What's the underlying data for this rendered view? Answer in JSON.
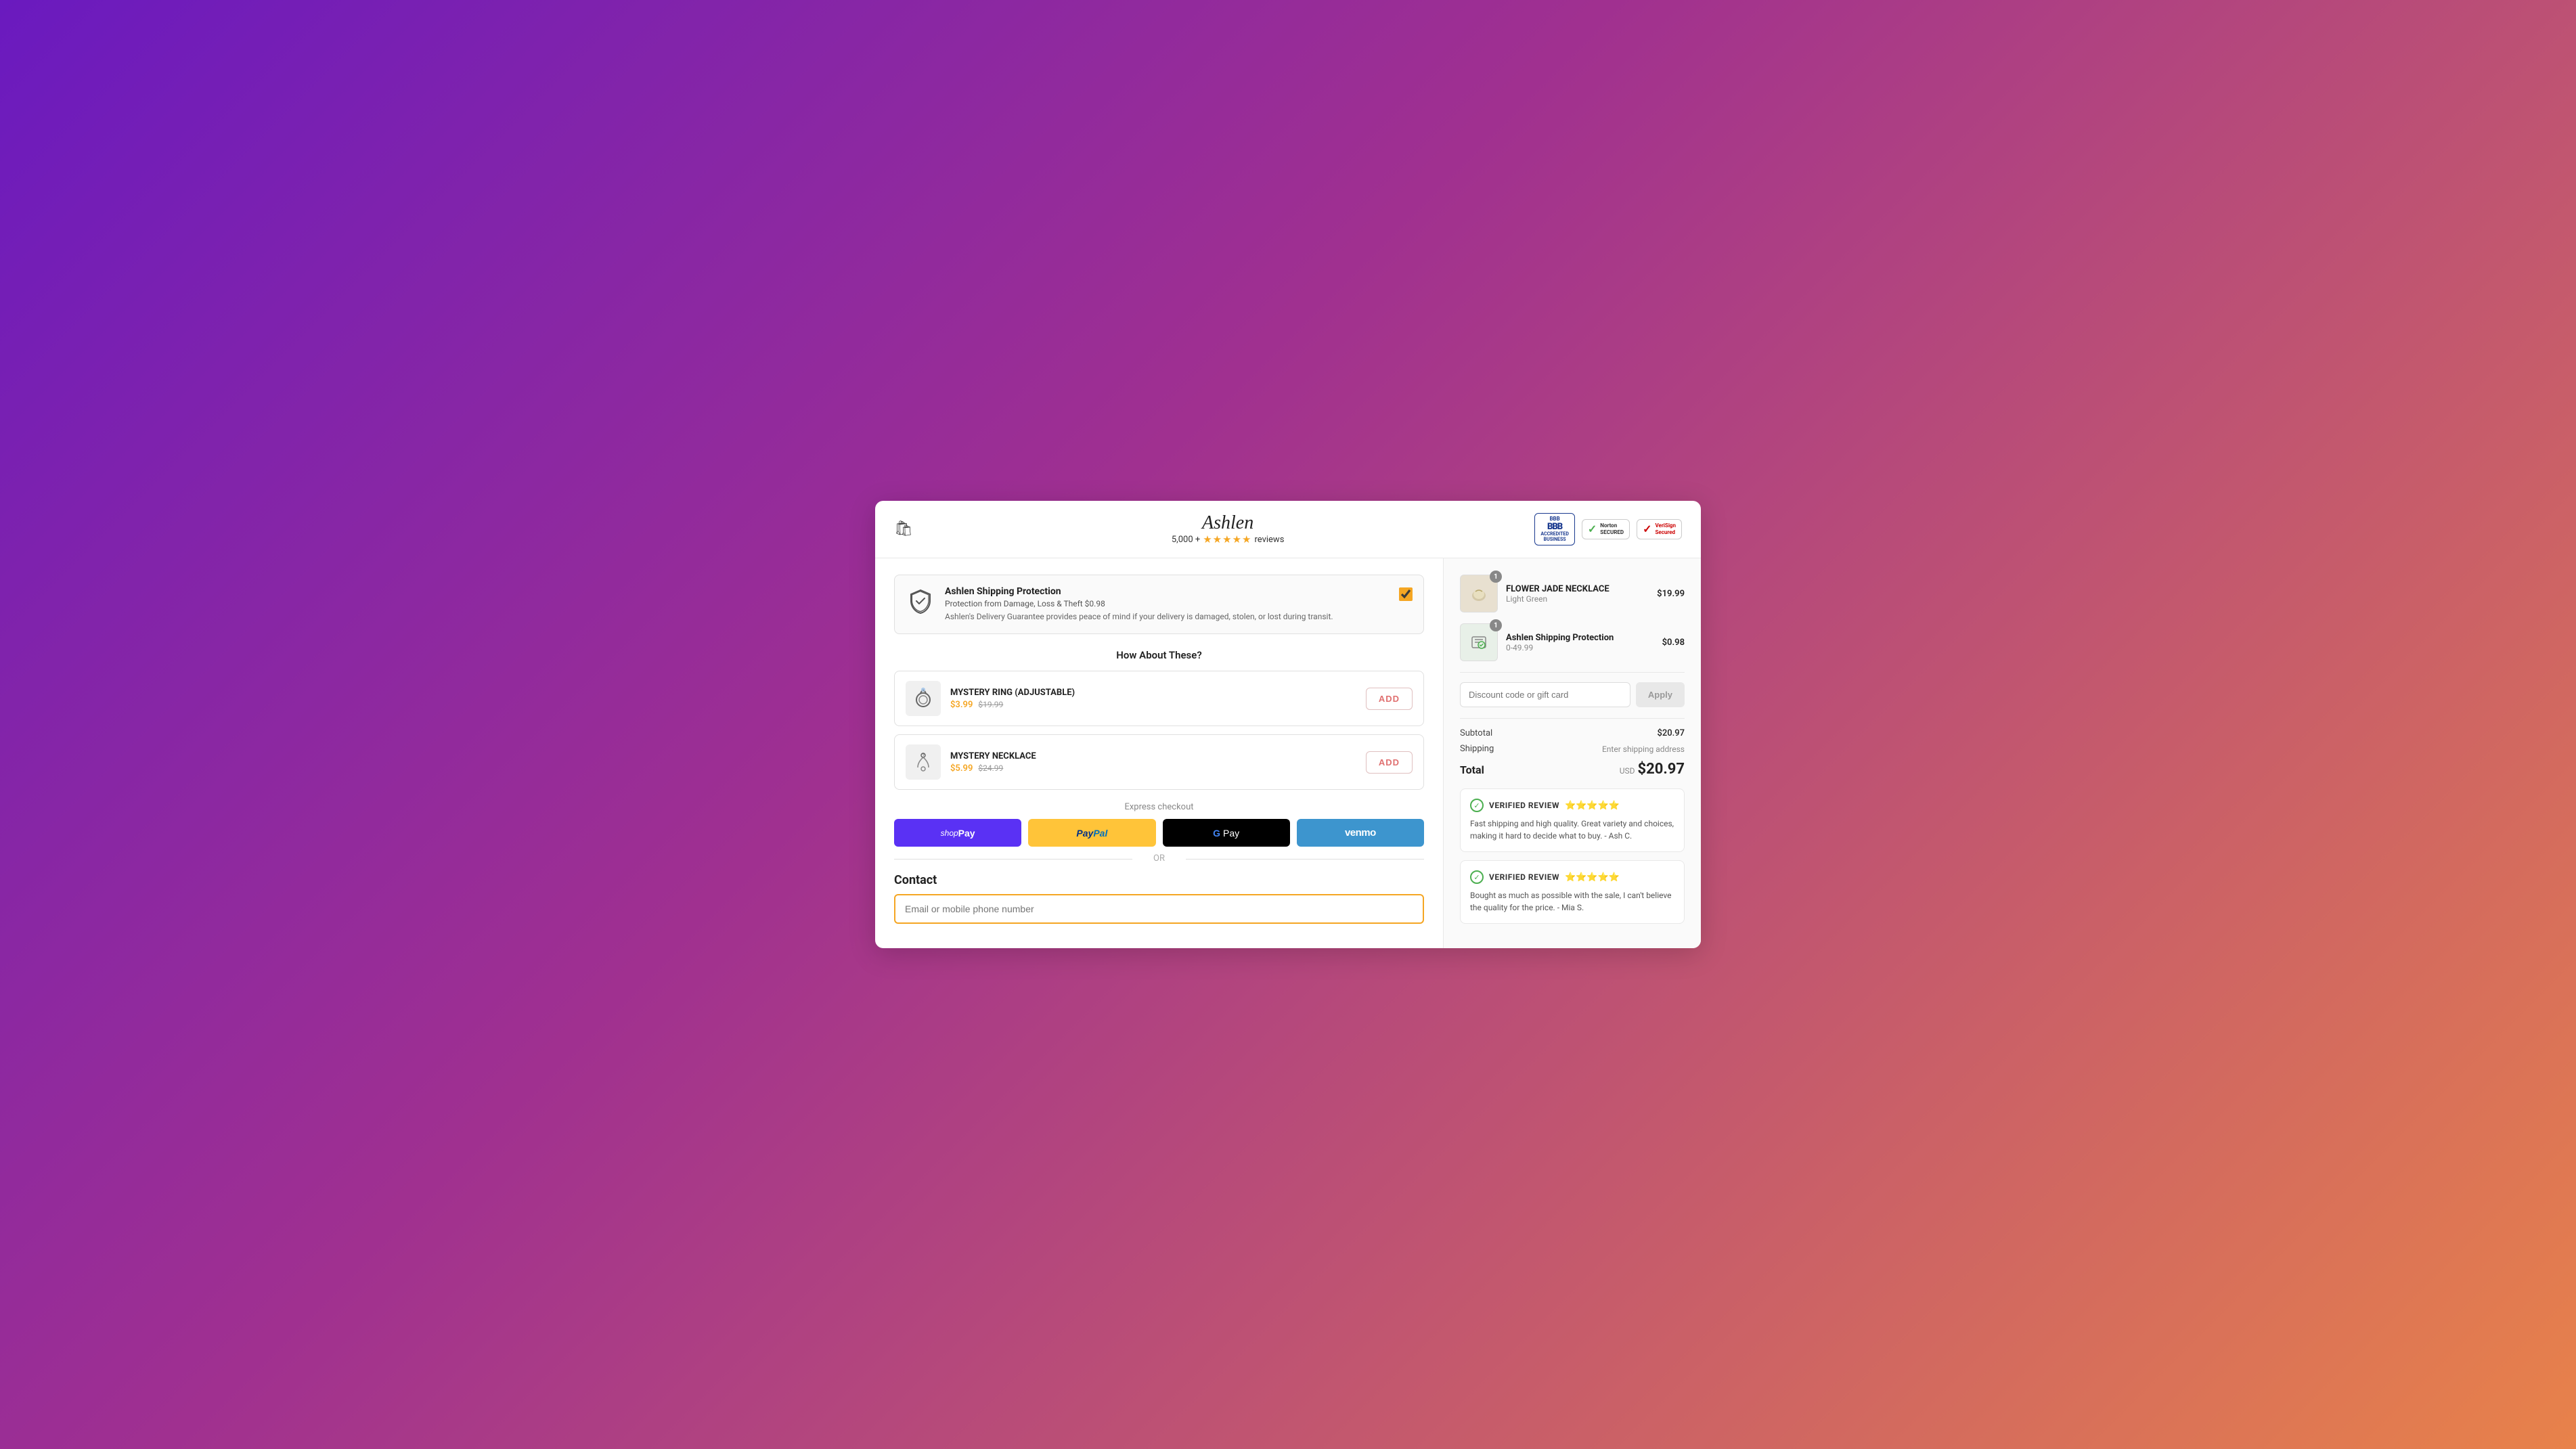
{
  "header": {
    "cart_icon": "🛍",
    "brand_name": "Ashlen",
    "reviews_prefix": "5,000 +",
    "reviews_suffix": "reviews",
    "stars": "★★★★★",
    "badge_bbb_line1": "BBB",
    "badge_bbb_line2": "ACCREDITED",
    "badge_bbb_line3": "BUSINESS",
    "badge_norton_check": "✓",
    "badge_norton_text": "Norton SECURED",
    "badge_verisign_check": "✓",
    "badge_verisign_text": "VeriSign Secured"
  },
  "shipping_protection": {
    "title": "Ashlen Shipping Protection",
    "subtitle": "Protection from Damage, Loss & Theft $0.98",
    "description": "Ashlen's Delivery Guarantee provides peace of mind if your delivery is damaged, stolen, or lost during transit.",
    "icon": "🛡",
    "checked": true
  },
  "upsell": {
    "section_title": "How About These?",
    "items": [
      {
        "name": "MYSTERY RING (ADJUSTABLE)",
        "sale_price": "$3.99",
        "original_price": "$19.99",
        "icon": "💍",
        "add_label": "ADD"
      },
      {
        "name": "MYSTERY NECKLACE",
        "sale_price": "$5.99",
        "original_price": "$24.99",
        "icon": "📿",
        "add_label": "ADD"
      }
    ]
  },
  "express_checkout": {
    "label": "Express checkout",
    "shoppay_label": "shopPay",
    "paypal_label": "PayPal",
    "gpay_label": "GPay",
    "venmo_label": "venmo",
    "or_label": "OR"
  },
  "contact": {
    "title": "Contact",
    "email_placeholder": "Email or mobile phone number"
  },
  "order_summary": {
    "items": [
      {
        "name": "FLOWER JADE NECKLACE",
        "variant": "Light Green",
        "price": "$19.99",
        "qty": "1",
        "icon": "🌸"
      },
      {
        "name": "Ashlen Shipping Protection",
        "variant": "0-49.99",
        "price": "$0.98",
        "qty": "1",
        "icon": "📦"
      }
    ],
    "discount_placeholder": "Discount code or gift card",
    "apply_label": "Apply",
    "subtotal_label": "Subtotal",
    "subtotal_value": "$20.97",
    "shipping_label": "Shipping",
    "shipping_note": "Enter shipping address",
    "total_label": "Total",
    "total_currency": "USD",
    "total_amount": "$20.97"
  },
  "reviews": [
    {
      "verified_label": "VERIFIED REVIEW",
      "stars": "⭐⭐⭐⭐⭐",
      "text": "Fast shipping and high quality. Great variety and choices, making it hard to decide what to buy.  - Ash C."
    },
    {
      "verified_label": "VERIFIED REVIEW",
      "stars": "⭐⭐⭐⭐⭐",
      "text": "Bought as much as possible with the sale, I can't believe the quality for the price. - Mia S."
    }
  ]
}
